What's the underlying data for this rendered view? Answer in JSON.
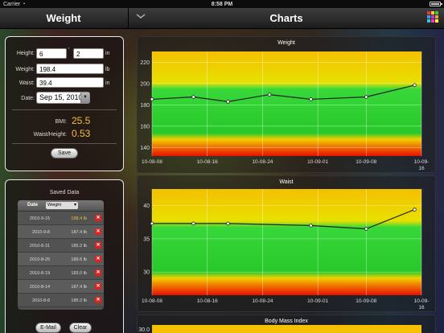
{
  "status": {
    "carrier": "Carrier",
    "time": "8:58 PM"
  },
  "nav": {
    "left_title": "Weight",
    "right_title": "Charts"
  },
  "form": {
    "height_label": "Height:",
    "height_ft": "6",
    "height_in": "2",
    "ft_unit": "'",
    "in_unit": "in",
    "weight_label": "Weight:",
    "weight": "198.4",
    "weight_unit": "lb",
    "waist_label": "Waist:",
    "waist": "39.4",
    "waist_unit": "in",
    "date_label": "Date:",
    "date": "Sep 15, 2010",
    "bmi_label": "BMI:",
    "bmi": "25.5",
    "wh_label": "Waist/Height:",
    "wh": "0.53",
    "save": "Save"
  },
  "saved": {
    "title": "Saved Data",
    "col_date": "Date",
    "col_select": "Weight",
    "rows": [
      {
        "date": "2010-9-15",
        "value": "198.4 lb",
        "highlight": true
      },
      {
        "date": "2010-9-8",
        "value": "187.4 lb",
        "highlight": false
      },
      {
        "date": "2010-8-31",
        "value": "185.2 lb",
        "highlight": false
      },
      {
        "date": "2010-8-25",
        "value": "189.6 lb",
        "highlight": false
      },
      {
        "date": "2010-8-19",
        "value": "183.0 lb",
        "highlight": false
      },
      {
        "date": "2010-8-14",
        "value": "187.4 lb",
        "highlight": false
      },
      {
        "date": "2010-8-8",
        "value": "185.2 lb",
        "highlight": false
      }
    ],
    "email": "E-Mail",
    "clear": "Clear"
  },
  "chart_data": [
    {
      "type": "line",
      "title": "Weight",
      "x": [
        "10-08-08",
        "10-08-14",
        "10-08-19",
        "10-08-25",
        "10-08-31",
        "10-09-08",
        "10-09-15"
      ],
      "x_ticks": [
        "10-08-08",
        "10-08-16",
        "10-08-24",
        "10-09-01",
        "10-09-08",
        "10-09-16"
      ],
      "values": [
        185.2,
        187.4,
        183.0,
        189.6,
        185.2,
        187.4,
        198.4
      ],
      "y_ticks": [
        140,
        160,
        180,
        200,
        220
      ],
      "ylim": [
        132,
        230
      ],
      "grid": true
    },
    {
      "type": "line",
      "title": "Waist",
      "x": [
        "10-08-08",
        "10-08-14",
        "10-08-19",
        "10-08-31",
        "10-09-08",
        "10-09-15"
      ],
      "x_ticks": [
        "10-08-08",
        "10-08-16",
        "10-08-24",
        "10-09-01",
        "10-09-08",
        "10-09-16"
      ],
      "values": [
        37.3,
        37.3,
        37.3,
        37.0,
        36.5,
        39.4
      ],
      "y_ticks": [
        30,
        35,
        40
      ],
      "ylim": [
        26.5,
        42.5
      ],
      "grid": true
    },
    {
      "type": "line",
      "title": "Body Mass Index",
      "x": [],
      "values": [],
      "y_ticks": [
        30.0
      ],
      "grid": true
    }
  ]
}
